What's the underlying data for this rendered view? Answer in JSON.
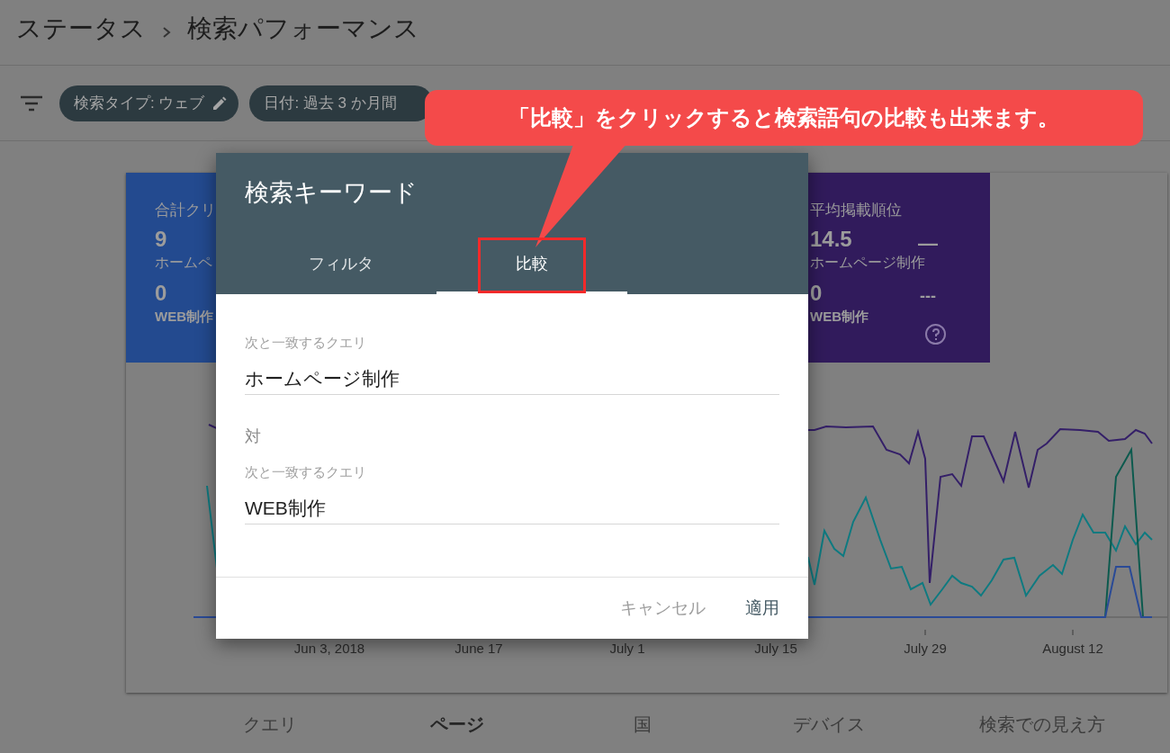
{
  "header": {
    "breadcrumb": [
      "ステータス",
      "検索パフォーマンス"
    ]
  },
  "filters": [
    {
      "label": "検索タイプ: ウェブ",
      "kind": "editable"
    },
    {
      "label": "日付: 過去 3 か月間",
      "kind": "plain"
    }
  ],
  "metric_cards": [
    {
      "kind": "clicks",
      "color": "#234a8f",
      "title": "合計クリ",
      "value_1": "9",
      "label_1": "ホームペ",
      "value_2": "0",
      "label_2": "WEB制作"
    },
    {
      "kind": "position",
      "color": "#311b5c",
      "title": "平均掲載順位",
      "value_1": "14.5",
      "label_1": "ホームページ制作",
      "value_2": "0",
      "label_2": "WEB制作",
      "legend_1": "—",
      "legend_2": "---",
      "help": true
    }
  ],
  "chart": {
    "x_labels": [
      "Jun 3, 2018",
      "June 17",
      "July 1",
      "July 15",
      "July 29",
      "August 12"
    ]
  },
  "bottom_tabs": [
    {
      "label": "クエリ",
      "selected": false
    },
    {
      "label": "ページ",
      "selected": true
    },
    {
      "label": "国",
      "selected": false
    },
    {
      "label": "デバイス",
      "selected": false
    },
    {
      "label": "検索での見え方",
      "selected": false
    }
  ],
  "dialog": {
    "title": "検索キーワード",
    "tabs": [
      {
        "label": "フィルタ",
        "selected": false,
        "highlighted": false
      },
      {
        "label": "比較",
        "selected": true,
        "highlighted": true
      }
    ],
    "fields": [
      {
        "label": "次と一致するクエリ",
        "value": "ホームページ制作"
      },
      {
        "label": "次と一致するクエリ",
        "value": "WEB制作"
      }
    ],
    "separator": "対",
    "buttons": [
      {
        "label": "キャンセル",
        "kind": "secondary"
      },
      {
        "label": "適用",
        "kind": "primary"
      }
    ]
  },
  "annotation": {
    "text": "「比較」をクリックすると検索語句の比較も出来ます。"
  }
}
